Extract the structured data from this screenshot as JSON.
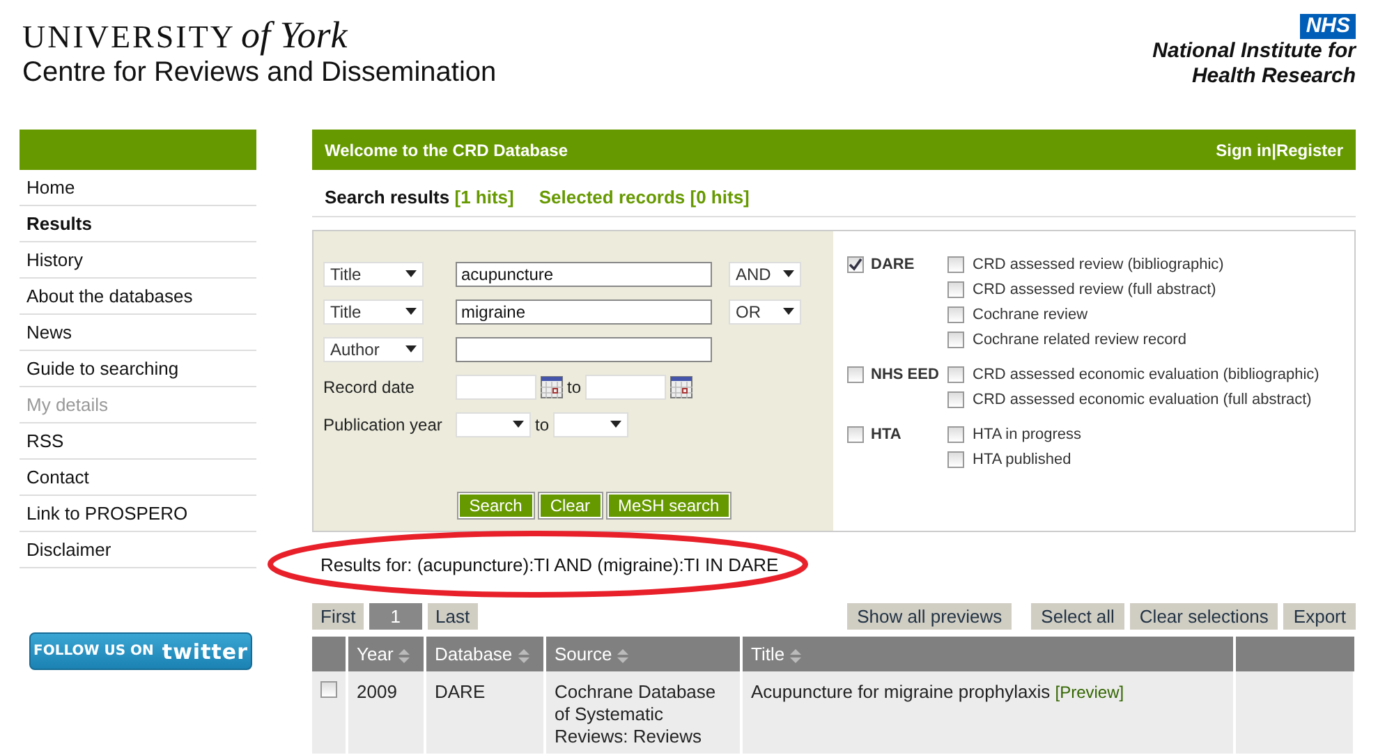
{
  "header": {
    "university": "UNIVERSITY",
    "university_suffix": "of York",
    "centre": "Centre for Reviews and Dissemination",
    "nhs_badge": "NHS",
    "institute_lines": [
      "National Institute for",
      "Health Research"
    ]
  },
  "sidebar": {
    "items": [
      {
        "label": "Home",
        "selected": false,
        "disabled": false
      },
      {
        "label": "Results",
        "selected": true,
        "disabled": false
      },
      {
        "label": "History",
        "selected": false,
        "disabled": false
      },
      {
        "label": "About the databases",
        "selected": false,
        "disabled": false
      },
      {
        "label": "News",
        "selected": false,
        "disabled": false
      },
      {
        "label": "Guide to searching",
        "selected": false,
        "disabled": false
      },
      {
        "label": "My details",
        "selected": false,
        "disabled": true
      },
      {
        "label": "RSS",
        "selected": false,
        "disabled": false
      },
      {
        "label": "Contact",
        "selected": false,
        "disabled": false
      },
      {
        "label": "Link to PROSPERO",
        "selected": false,
        "disabled": false
      },
      {
        "label": "Disclaimer",
        "selected": false,
        "disabled": false
      }
    ],
    "twitter_button": {
      "prefix": "FOLLOW US ON",
      "brand": "twitter"
    }
  },
  "banner": {
    "title": "Welcome to the CRD Database",
    "links": [
      "Sign in",
      "Register"
    ],
    "separator": "|"
  },
  "tabs": [
    {
      "label": "Search results",
      "count": "[1 hits]",
      "selected": true
    },
    {
      "label": "Selected records",
      "count": "[0 hits]",
      "selected": false
    }
  ],
  "search": {
    "rows": [
      {
        "field": "Title",
        "value": "acupuncture",
        "operator": "AND"
      },
      {
        "field": "Title",
        "value": "migraine",
        "operator": "OR"
      },
      {
        "field": "Author",
        "value": ""
      }
    ],
    "record_date": {
      "label": "Record date",
      "to": "to"
    },
    "publication_year": {
      "label": "Publication year",
      "to": "to"
    },
    "buttons": [
      "Search",
      "Clear",
      "MeSH search"
    ],
    "databases": [
      {
        "name": "DARE",
        "checked": true,
        "options": [
          {
            "label": "CRD assessed review (bibliographic)",
            "checked": false
          },
          {
            "label": "CRD assessed review (full abstract)",
            "checked": false
          },
          {
            "label": "Cochrane review",
            "checked": false
          },
          {
            "label": "Cochrane related review record",
            "checked": false
          }
        ]
      },
      {
        "name": "NHS EED",
        "checked": false,
        "options": [
          {
            "label": "CRD assessed economic evaluation (bibliographic)",
            "checked": false
          },
          {
            "label": "CRD assessed economic evaluation (full abstract)",
            "checked": false
          }
        ]
      },
      {
        "name": "HTA",
        "checked": false,
        "options": [
          {
            "label": "HTA in progress",
            "checked": false
          },
          {
            "label": "HTA published",
            "checked": false
          }
        ]
      }
    ]
  },
  "results_query": "Results for: (acupuncture):TI AND (migraine):TI IN DARE",
  "pager": [
    {
      "label": "First",
      "selected": false
    },
    {
      "label": "1",
      "selected": true
    },
    {
      "label": "Last",
      "selected": false
    }
  ],
  "actions": [
    "Show all previews",
    "Select all",
    "Clear selections",
    "Export"
  ],
  "table": {
    "columns": [
      {
        "label": "Year",
        "sortable": true
      },
      {
        "label": "Database",
        "sortable": true
      },
      {
        "label": "Source",
        "sortable": true
      },
      {
        "label": "Title",
        "sortable": true
      }
    ],
    "rows": [
      {
        "checked": false,
        "year": "2009",
        "database": "DARE",
        "source": "Cochrane Database of Systematic Reviews: Reviews",
        "title": "Acupuncture for migraine prophylaxis",
        "preview": "[Preview]"
      }
    ]
  }
}
